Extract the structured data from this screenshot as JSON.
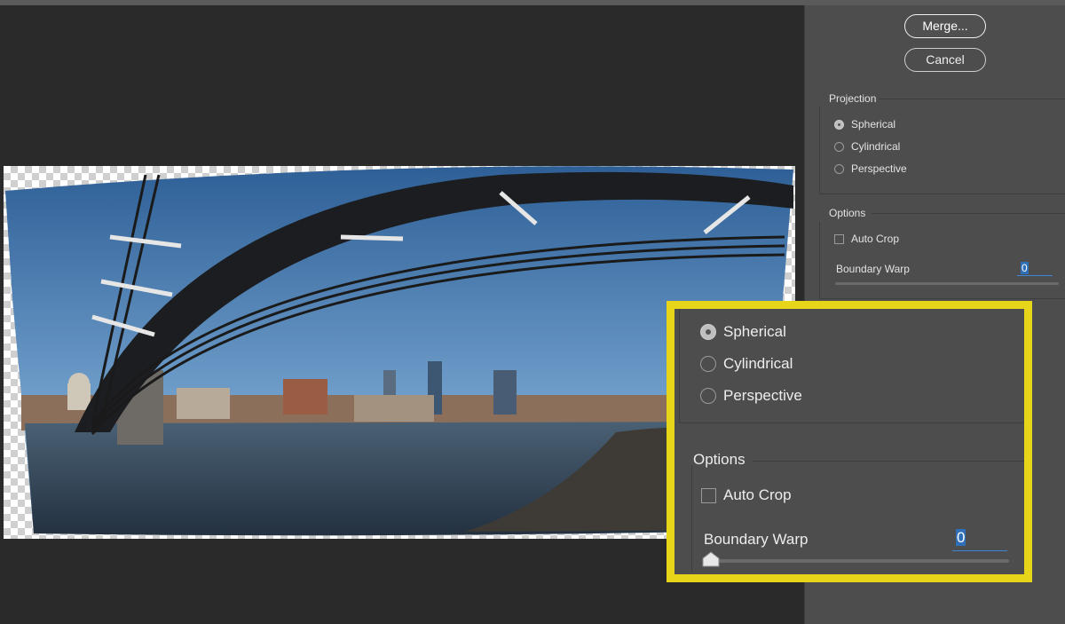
{
  "buttons": {
    "merge": "Merge...",
    "cancel": "Cancel"
  },
  "projection": {
    "title": "Projection",
    "options": [
      "Spherical",
      "Cylindrical",
      "Perspective"
    ],
    "selected": "Spherical"
  },
  "options": {
    "title": "Options",
    "auto_crop_label": "Auto Crop",
    "auto_crop_checked": false,
    "boundary_warp_label": "Boundary Warp",
    "boundary_warp_value": "0",
    "boundary_warp_fraction": 0
  },
  "colors": {
    "highlight_border": "#e7d51a",
    "focus_underline": "#3d86d6",
    "panel_bg": "#4d4d4d"
  },
  "icons": {
    "preview": "panorama-preview-image"
  }
}
